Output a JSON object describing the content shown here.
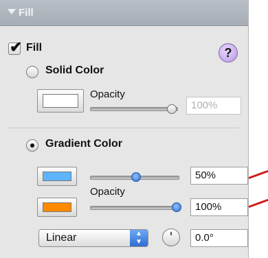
{
  "titlebar": {
    "title": "Fill"
  },
  "fill": {
    "label": "Fill",
    "checked": true
  },
  "help": {
    "label": "?"
  },
  "solid": {
    "label": "Solid Color",
    "selected": false,
    "opacity_label": "Opacity",
    "opacity_value": "100%",
    "opacity_fraction": 1.0,
    "swatch_color": "#ffffff"
  },
  "gradient": {
    "label": "Gradient Color",
    "selected": true,
    "stop1": {
      "color": "#5fb4ff",
      "value": "50%",
      "fraction": 0.5
    },
    "opacity_label": "Opacity",
    "stop2": {
      "color": "#ff8a00",
      "value": "100%",
      "fraction": 1.0
    }
  },
  "type_select": {
    "value": "Linear"
  },
  "angle": {
    "value": "0.0°"
  },
  "colors": {
    "annotation": "#d01a1a"
  }
}
